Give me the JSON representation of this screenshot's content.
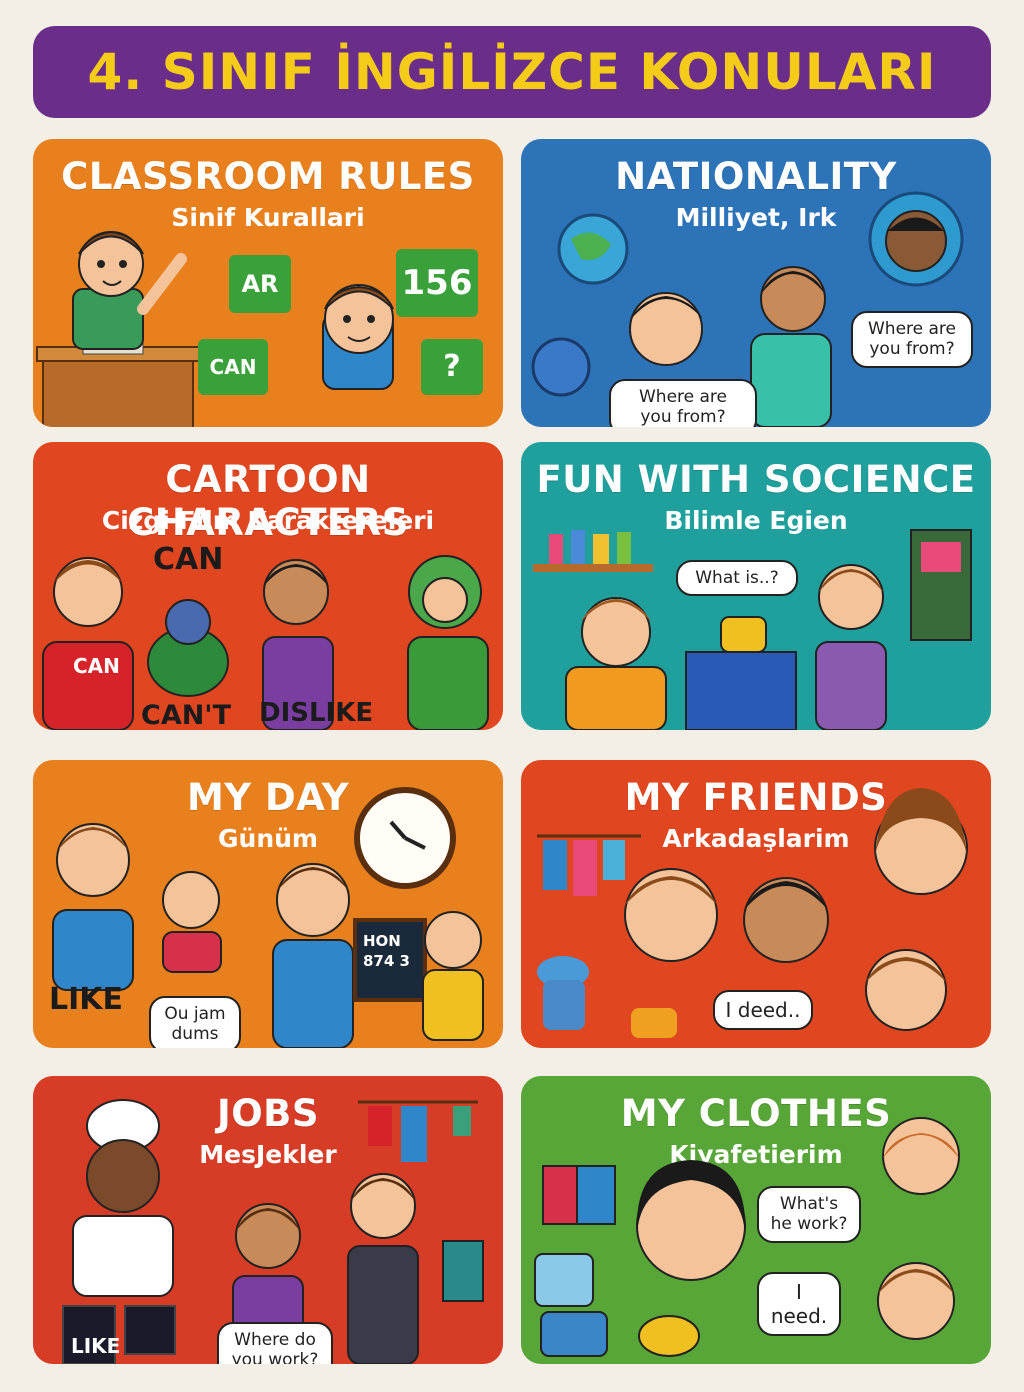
{
  "title": "4. SINIF İNGİLİZCE KONULARI",
  "colors": {
    "title_bg": "#6a2d8a",
    "title_text": "#f4cc18",
    "orange": "#e8801e",
    "red": "#e0461f",
    "blue": "#2d73b8",
    "teal": "#20a09c",
    "green": "#58a637"
  },
  "cards": [
    {
      "title": "CLASSROOM RULES",
      "subtitle": "Sinif Kurallari",
      "tags": [
        "AR",
        "156",
        "CAN",
        "?"
      ]
    },
    {
      "title": "NATIONALITY",
      "subtitle": "Milliyet, Irk",
      "bubbles": [
        "Where are you from?",
        "Where are you from?"
      ]
    },
    {
      "title": "CARTOON CHARACTERS",
      "subtitle": "Cizgi Film Karaktereleri",
      "words": [
        "CAN",
        "CAN",
        "CAN'T",
        "DISLIKE"
      ]
    },
    {
      "title": "FUN WITH SOCIENCE",
      "subtitle": "Bilimle Egien",
      "bubbles": [
        "What is..?"
      ]
    },
    {
      "title": "MY DAY",
      "subtitle": "Günüm",
      "words": [
        "LIKE"
      ],
      "bubbles": [
        "Ou jam dums"
      ],
      "board_text": "HON 874 3"
    },
    {
      "title": "MY FRIENDS",
      "subtitle": "Arkadaşlarim",
      "bubbles": [
        "I deed.."
      ]
    },
    {
      "title": "JOBS",
      "subtitle": "MesJekler",
      "words": [
        "LIKE"
      ],
      "bubbles": [
        "Where do you work?"
      ]
    },
    {
      "title": "MY CLOTHES",
      "subtitle": "Kiyafetierim",
      "bubbles": [
        "What's he work?",
        "I need."
      ]
    }
  ]
}
